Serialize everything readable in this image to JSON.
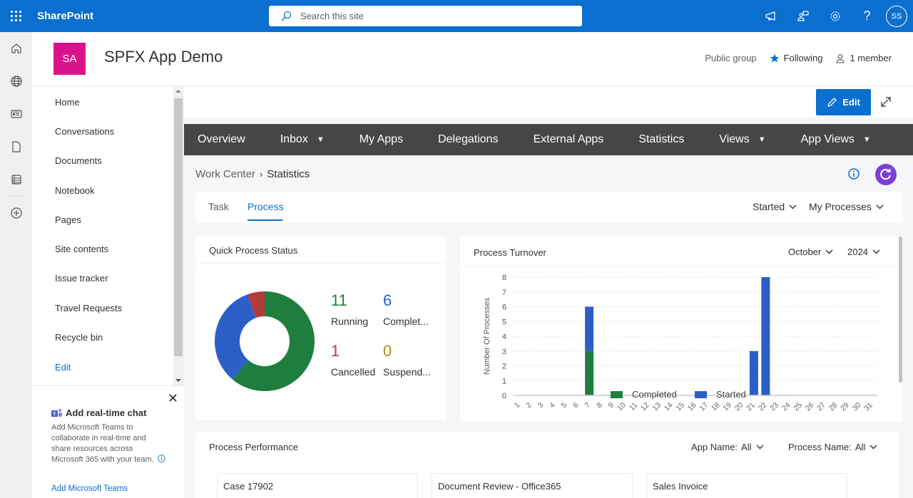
{
  "suite": {
    "brand": "SharePoint",
    "search_placeholder": "Search this site",
    "avatar_initials": "SS",
    "icons": [
      "megaphone-icon",
      "teams-chat-icon",
      "gear-icon",
      "help-icon"
    ]
  },
  "rail": {
    "icons": [
      "home-icon",
      "globe-icon",
      "news-icon",
      "document-icon",
      "lists-icon",
      "create-icon"
    ]
  },
  "site": {
    "logo_initials": "SA",
    "logo_color": "#d9128c",
    "title": "SPFX App Demo",
    "privacy": "Public group",
    "following": "Following",
    "members": "1 member"
  },
  "leftnav": {
    "items": [
      {
        "label": "Home"
      },
      {
        "label": "Conversations"
      },
      {
        "label": "Documents"
      },
      {
        "label": "Notebook"
      },
      {
        "label": "Pages"
      },
      {
        "label": "Site contents"
      },
      {
        "label": "Issue tracker"
      },
      {
        "label": "Travel Requests"
      },
      {
        "label": "Recycle bin"
      }
    ],
    "edit_label": "Edit"
  },
  "teams_card": {
    "title": "Add real-time chat",
    "description": "Add Microsoft Teams to collaborate in real-time and share resources across Microsoft 365 with your team.",
    "link": "Add Microsoft Teams"
  },
  "commandbar": {
    "edit_label": "Edit"
  },
  "app_nav": {
    "tabs": [
      {
        "label": "Overview",
        "dropdown": false
      },
      {
        "label": "Inbox",
        "dropdown": true
      },
      {
        "label": "My Apps",
        "dropdown": false
      },
      {
        "label": "Delegations",
        "dropdown": false
      },
      {
        "label": "External Apps",
        "dropdown": false
      },
      {
        "label": "Statistics",
        "dropdown": false
      },
      {
        "label": "Views",
        "dropdown": true
      },
      {
        "label": "App Views",
        "dropdown": true
      }
    ]
  },
  "breadcrumb": {
    "root": "Work Center",
    "current": "Statistics"
  },
  "stat_tabs": {
    "tabs": [
      "Task",
      "Process"
    ],
    "active": "Process",
    "filter_status": "Started",
    "filter_scope": "My Processes"
  },
  "quick_status": {
    "title": "Quick Process Status",
    "items": [
      {
        "label": "Running",
        "value": 11,
        "color": "#1e7e3e"
      },
      {
        "label": "Complet...",
        "value": 6,
        "color": "#2b5fc7"
      },
      {
        "label": "Cancelled",
        "value": 1,
        "color": "#b33a3a"
      },
      {
        "label": "Suspend...",
        "value": 0,
        "color": "#b5861b"
      }
    ]
  },
  "turnover": {
    "title": "Process Turnover",
    "month": "October",
    "year": "2024"
  },
  "chart_data": {
    "type": "bar",
    "stacked": true,
    "title": "Process Turnover",
    "xlabel": "",
    "ylabel": "Number Of Processes",
    "ylim": [
      0,
      8
    ],
    "yticks": [
      0,
      1,
      2,
      3,
      4,
      5,
      6,
      7,
      8
    ],
    "grid": true,
    "legend": "bottom",
    "categories": [
      "1",
      "2",
      "3",
      "4",
      "5",
      "6",
      "7",
      "8",
      "9",
      "10",
      "11",
      "12",
      "13",
      "14",
      "15",
      "16",
      "17",
      "18",
      "19",
      "20",
      "21",
      "22",
      "23",
      "24",
      "25",
      "26",
      "27",
      "28",
      "29",
      "30",
      "31"
    ],
    "series": [
      {
        "name": "Completed",
        "color": "#1e7e3e",
        "values": [
          0,
          0,
          0,
          0,
          0,
          0,
          3,
          0,
          0,
          0,
          0,
          0,
          0,
          0,
          0,
          0,
          0,
          0,
          0,
          0,
          0,
          0,
          0,
          0,
          0,
          0,
          0,
          0,
          0,
          0,
          0
        ]
      },
      {
        "name": "Started",
        "color": "#2b5fc7",
        "values": [
          0,
          0,
          0,
          0,
          0,
          0,
          3,
          0,
          0,
          0,
          0,
          0,
          0,
          0,
          0,
          0,
          0,
          0,
          0,
          0,
          3,
          8,
          0,
          0,
          0,
          0,
          0,
          0,
          0,
          0,
          0
        ]
      }
    ]
  },
  "performance": {
    "title": "Process Performance",
    "app_name_label": "App Name:",
    "app_name_value": "All",
    "process_name_label": "Process Name:",
    "process_name_value": "All",
    "items": [
      "Case 17902",
      "Document Review - Office365",
      "Sales Invoice"
    ]
  }
}
